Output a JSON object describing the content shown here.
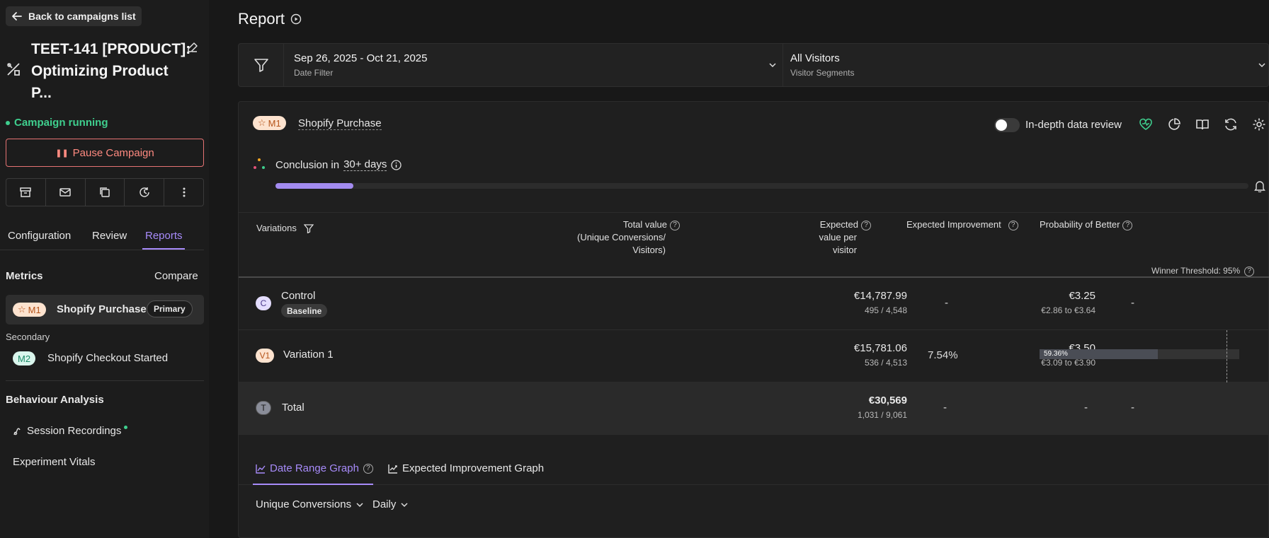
{
  "sidebar": {
    "back_label": "Back to campaigns list",
    "campaign_title_line1": "TEET-141 [PRODUCT]:",
    "campaign_title_line2": "Optimizing Product",
    "campaign_title_line3": "P...",
    "status": "Campaign running",
    "pause_label": "Pause Campaign",
    "action_icons": [
      "archive-icon",
      "mail-icon",
      "copy-icon",
      "history-icon",
      "more-icon"
    ],
    "tabs": [
      "Configuration",
      "Review",
      "Reports"
    ],
    "active_tab": "Reports",
    "metrics_heading": "Metrics",
    "compare_label": "Compare",
    "primary_metric": {
      "badge": "M1",
      "name": "Shopify Purchase",
      "tag": "Primary"
    },
    "secondary_label": "Secondary",
    "secondary_metric": {
      "badge": "M2",
      "name": "Shopify Checkout Started"
    },
    "behaviour_heading": "Behaviour Analysis",
    "session_recordings": "Session Recordings",
    "experiment_vitals": "Experiment Vitals"
  },
  "main": {
    "title": "Report",
    "date_filter": {
      "value": "Sep 26, 2025 - Oct 21, 2025",
      "label": "Date Filter"
    },
    "segment_filter": {
      "value": "All Visitors",
      "label": "Visitor Segments"
    },
    "metric": {
      "badge": "M1",
      "name": "Shopify Purchase"
    },
    "indepth_label": "In-depth data review",
    "indepth_enabled": false,
    "conclusion_prefix": "Conclusion in",
    "conclusion_value": "30+ days",
    "conclusion_progress": 0.08,
    "header_icons": [
      "health-icon",
      "pie-chart-icon",
      "book-icon",
      "refresh-icon",
      "settings-icon"
    ],
    "columns": {
      "variations": "Variations",
      "total_value_1": "Total value",
      "total_value_2": "(Unique Conversions/",
      "total_value_3": "Visitors)",
      "expected_1": "Expected",
      "expected_2": "value per",
      "expected_3": "visitor",
      "improvement": "Expected Improvement",
      "probability": "Probability of Better"
    },
    "winner_threshold": "Winner Threshold: 95%",
    "rows": [
      {
        "badge": "C",
        "name": "Control",
        "tag": "Baseline",
        "total": "€14,787.99",
        "conv": "495 / 4,548",
        "expected": "€3.25",
        "range": "€2.86 to €3.64",
        "improvement": "-",
        "probability": "-"
      },
      {
        "badge": "V1",
        "name": "Variation 1",
        "total": "€15,781.06",
        "conv": "536 / 4,513",
        "expected": "€3.50",
        "range": "€3.09 to €3.90",
        "improvement": "7.54%",
        "probability": "59.36%",
        "probability_value": 0.5936
      }
    ],
    "total_row": {
      "badge": "T",
      "name": "Total",
      "total": "€30,569",
      "conv": "1,031 / 9,061",
      "expected": "-",
      "improvement": "-",
      "probability": "-"
    },
    "graph_tabs": [
      "Date Range Graph",
      "Expected Improvement Graph"
    ],
    "metric_dropdown": "Unique Conversions",
    "interval_dropdown": "Daily",
    "colors": {
      "accent": "#a78bfa",
      "running": "#3fcf8e",
      "pause": "#ff8a80"
    }
  }
}
